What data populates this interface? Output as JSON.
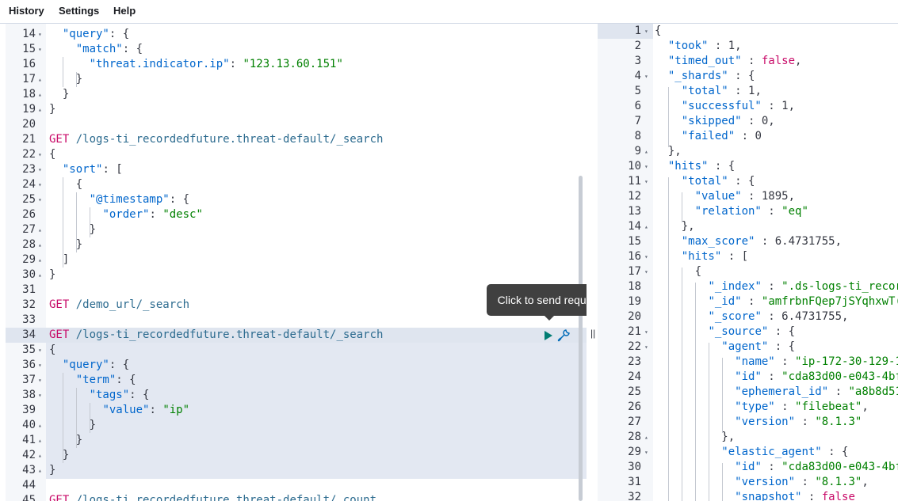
{
  "menu": {
    "history": "History",
    "settings": "Settings",
    "help": "Help"
  },
  "tooltip": {
    "send_request": "Click to send request"
  },
  "divider_glyph": "||",
  "icons": {
    "play": "play-icon",
    "wrench": "wrench-icon"
  },
  "colors": {
    "method": "#c80a68",
    "key": "#0066cc",
    "string": "#008000",
    "tooltip_bg": "#404040"
  },
  "editor_lines": [
    {
      "n": "14",
      "fold": "▾",
      "code": [
        [
          "  ",
          "punc"
        ],
        [
          "\"query\"",
          "k"
        ],
        [
          ": {",
          "punc"
        ]
      ]
    },
    {
      "n": "15",
      "fold": "▾",
      "code": [
        [
          "    ",
          "punc"
        ],
        [
          "\"match\"",
          "k"
        ],
        [
          ": {",
          "punc"
        ]
      ]
    },
    {
      "n": "16",
      "fold": "",
      "code": [
        [
          "      ",
          "punc"
        ],
        [
          "\"threat.indicator.ip\"",
          "k"
        ],
        [
          ": ",
          "punc"
        ],
        [
          "\"123.13.60.151\"",
          "s"
        ]
      ]
    },
    {
      "n": "17",
      "fold": "▴",
      "code": [
        [
          "    }",
          "punc"
        ]
      ]
    },
    {
      "n": "18",
      "fold": "▴",
      "code": [
        [
          "  }",
          "punc"
        ]
      ]
    },
    {
      "n": "19",
      "fold": "▴",
      "code": [
        [
          "}",
          "punc"
        ]
      ]
    },
    {
      "n": "20",
      "fold": "",
      "code": []
    },
    {
      "n": "21",
      "fold": "",
      "code": [
        [
          "GET ",
          "method"
        ],
        [
          "/logs-ti_recordedfuture.threat-default/_search",
          "url"
        ]
      ]
    },
    {
      "n": "22",
      "fold": "▾",
      "code": [
        [
          "{",
          "punc"
        ]
      ]
    },
    {
      "n": "23",
      "fold": "▾",
      "code": [
        [
          "  ",
          "punc"
        ],
        [
          "\"sort\"",
          "k"
        ],
        [
          ": [",
          "punc"
        ]
      ]
    },
    {
      "n": "24",
      "fold": "▾",
      "code": [
        [
          "    {",
          "punc"
        ]
      ]
    },
    {
      "n": "25",
      "fold": "▾",
      "code": [
        [
          "      ",
          "punc"
        ],
        [
          "\"@timestamp\"",
          "k"
        ],
        [
          ": {",
          "punc"
        ]
      ]
    },
    {
      "n": "26",
      "fold": "",
      "code": [
        [
          "        ",
          "punc"
        ],
        [
          "\"order\"",
          "k"
        ],
        [
          ": ",
          "punc"
        ],
        [
          "\"desc\"",
          "s"
        ]
      ]
    },
    {
      "n": "27",
      "fold": "▴",
      "code": [
        [
          "      }",
          "punc"
        ]
      ]
    },
    {
      "n": "28",
      "fold": "▴",
      "code": [
        [
          "    }",
          "punc"
        ]
      ]
    },
    {
      "n": "29",
      "fold": "▴",
      "code": [
        [
          "  ]",
          "punc"
        ]
      ]
    },
    {
      "n": "30",
      "fold": "▴",
      "code": [
        [
          "}",
          "punc"
        ]
      ]
    },
    {
      "n": "31",
      "fold": "",
      "code": []
    },
    {
      "n": "32",
      "fold": "",
      "code": [
        [
          "GET ",
          "method"
        ],
        [
          "/demo_url/_search",
          "url"
        ]
      ]
    },
    {
      "n": "33",
      "fold": "",
      "code": []
    },
    {
      "n": "34",
      "fold": "",
      "code": [
        [
          "GET ",
          "method"
        ],
        [
          "/logs-ti_recordedfuture.threat-default/_search",
          "url"
        ]
      ]
    },
    {
      "n": "35",
      "fold": "▾",
      "code": [
        [
          "{",
          "punc"
        ]
      ]
    },
    {
      "n": "36",
      "fold": "▾",
      "code": [
        [
          "  ",
          "punc"
        ],
        [
          "\"query\"",
          "k"
        ],
        [
          ": {",
          "punc"
        ]
      ]
    },
    {
      "n": "37",
      "fold": "▾",
      "code": [
        [
          "    ",
          "punc"
        ],
        [
          "\"term\"",
          "k"
        ],
        [
          ": {",
          "punc"
        ]
      ]
    },
    {
      "n": "38",
      "fold": "▾",
      "code": [
        [
          "      ",
          "punc"
        ],
        [
          "\"tags\"",
          "k"
        ],
        [
          ": {",
          "punc"
        ]
      ]
    },
    {
      "n": "39",
      "fold": "",
      "code": [
        [
          "        ",
          "punc"
        ],
        [
          "\"value\"",
          "k"
        ],
        [
          ": ",
          "punc"
        ],
        [
          "\"ip\"",
          "s"
        ]
      ]
    },
    {
      "n": "40",
      "fold": "▴",
      "code": [
        [
          "      }",
          "punc"
        ]
      ]
    },
    {
      "n": "41",
      "fold": "▴",
      "code": [
        [
          "    }",
          "punc"
        ]
      ]
    },
    {
      "n": "42",
      "fold": "▴",
      "code": [
        [
          "  }",
          "punc"
        ]
      ]
    },
    {
      "n": "43",
      "fold": "▴",
      "code": [
        [
          "}",
          "punc"
        ]
      ]
    },
    {
      "n": "44",
      "fold": "",
      "code": []
    },
    {
      "n": "45",
      "fold": "",
      "code": [
        [
          "GET ",
          "method"
        ],
        [
          "/logs-ti_recordedfuture.threat-default/_count",
          "url"
        ]
      ]
    }
  ],
  "output_lines": [
    {
      "n": "1",
      "fold": "▾",
      "code": [
        [
          "{",
          "punc"
        ]
      ]
    },
    {
      "n": "2",
      "fold": "",
      "code": [
        [
          "  ",
          "punc"
        ],
        [
          "\"took\"",
          "k"
        ],
        [
          " : 1,",
          "punc"
        ]
      ]
    },
    {
      "n": "3",
      "fold": "",
      "code": [
        [
          "  ",
          "punc"
        ],
        [
          "\"timed_out\"",
          "k"
        ],
        [
          " : ",
          "punc"
        ],
        [
          "false",
          "bool"
        ],
        [
          ",",
          "punc"
        ]
      ]
    },
    {
      "n": "4",
      "fold": "▾",
      "code": [
        [
          "  ",
          "punc"
        ],
        [
          "\"_shards\"",
          "k"
        ],
        [
          " : {",
          "punc"
        ]
      ]
    },
    {
      "n": "5",
      "fold": "",
      "code": [
        [
          "    ",
          "punc"
        ],
        [
          "\"total\"",
          "k"
        ],
        [
          " : 1,",
          "punc"
        ]
      ]
    },
    {
      "n": "6",
      "fold": "",
      "code": [
        [
          "    ",
          "punc"
        ],
        [
          "\"successful\"",
          "k"
        ],
        [
          " : 1,",
          "punc"
        ]
      ]
    },
    {
      "n": "7",
      "fold": "",
      "code": [
        [
          "    ",
          "punc"
        ],
        [
          "\"skipped\"",
          "k"
        ],
        [
          " : 0,",
          "punc"
        ]
      ]
    },
    {
      "n": "8",
      "fold": "",
      "code": [
        [
          "    ",
          "punc"
        ],
        [
          "\"failed\"",
          "k"
        ],
        [
          " : 0",
          "punc"
        ]
      ]
    },
    {
      "n": "9",
      "fold": "▴",
      "code": [
        [
          "  },",
          "punc"
        ]
      ]
    },
    {
      "n": "10",
      "fold": "▾",
      "code": [
        [
          "  ",
          "punc"
        ],
        [
          "\"hits\"",
          "k"
        ],
        [
          " : {",
          "punc"
        ]
      ]
    },
    {
      "n": "11",
      "fold": "▾",
      "code": [
        [
          "    ",
          "punc"
        ],
        [
          "\"total\"",
          "k"
        ],
        [
          " : {",
          "punc"
        ]
      ]
    },
    {
      "n": "12",
      "fold": "",
      "code": [
        [
          "      ",
          "punc"
        ],
        [
          "\"value\"",
          "k"
        ],
        [
          " : 1895,",
          "punc"
        ]
      ]
    },
    {
      "n": "13",
      "fold": "",
      "code": [
        [
          "      ",
          "punc"
        ],
        [
          "\"relation\"",
          "k"
        ],
        [
          " : ",
          "punc"
        ],
        [
          "\"eq\"",
          "s"
        ]
      ]
    },
    {
      "n": "14",
      "fold": "▴",
      "code": [
        [
          "    },",
          "punc"
        ]
      ]
    },
    {
      "n": "15",
      "fold": "",
      "code": [
        [
          "    ",
          "punc"
        ],
        [
          "\"max_score\"",
          "k"
        ],
        [
          " : 6.4731755,",
          "punc"
        ]
      ]
    },
    {
      "n": "16",
      "fold": "▾",
      "code": [
        [
          "    ",
          "punc"
        ],
        [
          "\"hits\"",
          "k"
        ],
        [
          " : [",
          "punc"
        ]
      ]
    },
    {
      "n": "17",
      "fold": "▾",
      "code": [
        [
          "      {",
          "punc"
        ]
      ]
    },
    {
      "n": "18",
      "fold": "",
      "code": [
        [
          "        ",
          "punc"
        ],
        [
          "\"_index\"",
          "k"
        ],
        [
          " : ",
          "punc"
        ],
        [
          "\".ds-logs-ti_recor",
          "s"
        ]
      ]
    },
    {
      "n": "19",
      "fold": "",
      "code": [
        [
          "        ",
          "punc"
        ],
        [
          "\"_id\"",
          "k"
        ],
        [
          " : ",
          "punc"
        ],
        [
          "\"amfrbnFQep7jSYqhxwT(",
          "s"
        ]
      ]
    },
    {
      "n": "20",
      "fold": "",
      "code": [
        [
          "        ",
          "punc"
        ],
        [
          "\"_score\"",
          "k"
        ],
        [
          " : 6.4731755,",
          "punc"
        ]
      ]
    },
    {
      "n": "21",
      "fold": "▾",
      "code": [
        [
          "        ",
          "punc"
        ],
        [
          "\"_source\"",
          "k"
        ],
        [
          " : {",
          "punc"
        ]
      ]
    },
    {
      "n": "22",
      "fold": "▾",
      "code": [
        [
          "          ",
          "punc"
        ],
        [
          "\"agent\"",
          "k"
        ],
        [
          " : {",
          "punc"
        ]
      ]
    },
    {
      "n": "23",
      "fold": "",
      "code": [
        [
          "            ",
          "punc"
        ],
        [
          "\"name\"",
          "k"
        ],
        [
          " : ",
          "punc"
        ],
        [
          "\"ip-172-30-129-1",
          "s"
        ]
      ]
    },
    {
      "n": "24",
      "fold": "",
      "code": [
        [
          "            ",
          "punc"
        ],
        [
          "\"id\"",
          "k"
        ],
        [
          " : ",
          "punc"
        ],
        [
          "\"cda83d00-e043-4bf",
          "s"
        ]
      ]
    },
    {
      "n": "25",
      "fold": "",
      "code": [
        [
          "            ",
          "punc"
        ],
        [
          "\"ephemeral_id\"",
          "k"
        ],
        [
          " : ",
          "punc"
        ],
        [
          "\"a8b8d51",
          "s"
        ]
      ]
    },
    {
      "n": "26",
      "fold": "",
      "code": [
        [
          "            ",
          "punc"
        ],
        [
          "\"type\"",
          "k"
        ],
        [
          " : ",
          "punc"
        ],
        [
          "\"filebeat\"",
          "s"
        ],
        [
          ",",
          "punc"
        ]
      ]
    },
    {
      "n": "27",
      "fold": "",
      "code": [
        [
          "            ",
          "punc"
        ],
        [
          "\"version\"",
          "k"
        ],
        [
          " : ",
          "punc"
        ],
        [
          "\"8.1.3\"",
          "s"
        ]
      ]
    },
    {
      "n": "28",
      "fold": "▴",
      "code": [
        [
          "          },",
          "punc"
        ]
      ]
    },
    {
      "n": "29",
      "fold": "▾",
      "code": [
        [
          "          ",
          "punc"
        ],
        [
          "\"elastic_agent\"",
          "k"
        ],
        [
          " : {",
          "punc"
        ]
      ]
    },
    {
      "n": "30",
      "fold": "",
      "code": [
        [
          "            ",
          "punc"
        ],
        [
          "\"id\"",
          "k"
        ],
        [
          " : ",
          "punc"
        ],
        [
          "\"cda83d00-e043-4bf",
          "s"
        ]
      ]
    },
    {
      "n": "31",
      "fold": "",
      "code": [
        [
          "            ",
          "punc"
        ],
        [
          "\"version\"",
          "k"
        ],
        [
          " : ",
          "punc"
        ],
        [
          "\"8.1.3\"",
          "s"
        ],
        [
          ",",
          "punc"
        ]
      ]
    },
    {
      "n": "32",
      "fold": "",
      "code": [
        [
          "            ",
          "punc"
        ],
        [
          "\"snapshot\"",
          "k"
        ],
        [
          " : ",
          "punc"
        ],
        [
          "false",
          "bool"
        ]
      ]
    }
  ]
}
